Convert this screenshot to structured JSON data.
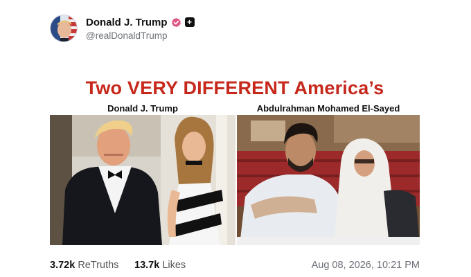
{
  "post": {
    "author": {
      "display_name": "Donald J. Trump",
      "handle": "@realDonaldTrump",
      "verified": true
    },
    "image": {
      "headline": "Two VERY DIFFERENT America’s",
      "left_label": "Donald J. Trump",
      "right_label": "Abdulrahman Mohamed El-Sayed"
    },
    "stats": {
      "retruths_count": "3.72k",
      "retruths_label": "ReTruths",
      "likes_count": "13.7k",
      "likes_label": "Likes"
    },
    "timestamp": "Aug 08, 2026, 10:21 PM"
  },
  "colors": {
    "headline": "#c6281c",
    "verified_badge": "#e05a8a",
    "muted_text": "#6b6f76"
  },
  "icons": {
    "verified": "verified-badge-icon",
    "follow": "plus-icon"
  }
}
